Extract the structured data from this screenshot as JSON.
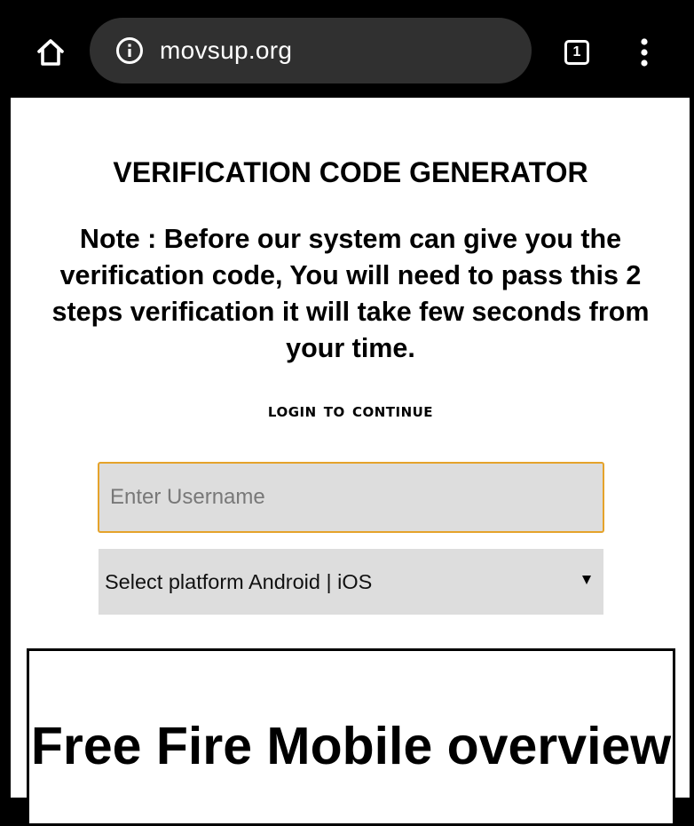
{
  "browser": {
    "url": "movsup.org",
    "tab_count": "1",
    "home_icon": "home-icon",
    "info_icon": "info-icon",
    "menu_icon": "more-vert-icon"
  },
  "page": {
    "title": "VERIFICATION CODE GENERATOR",
    "note": "Note : Before our system can give you the verification code, You will need to pass this 2 steps verification it will take few seconds from your time.",
    "login_label": "login to continue",
    "username_placeholder": "Enter Username",
    "platform_select": "Select platform Android | iOS",
    "overview_title": "Free Fire Mobile overview"
  },
  "colors": {
    "browser_bar": "#000000",
    "url_pill": "#303030",
    "input_background": "#dddddd",
    "input_focus_border": "#e5a32b"
  }
}
